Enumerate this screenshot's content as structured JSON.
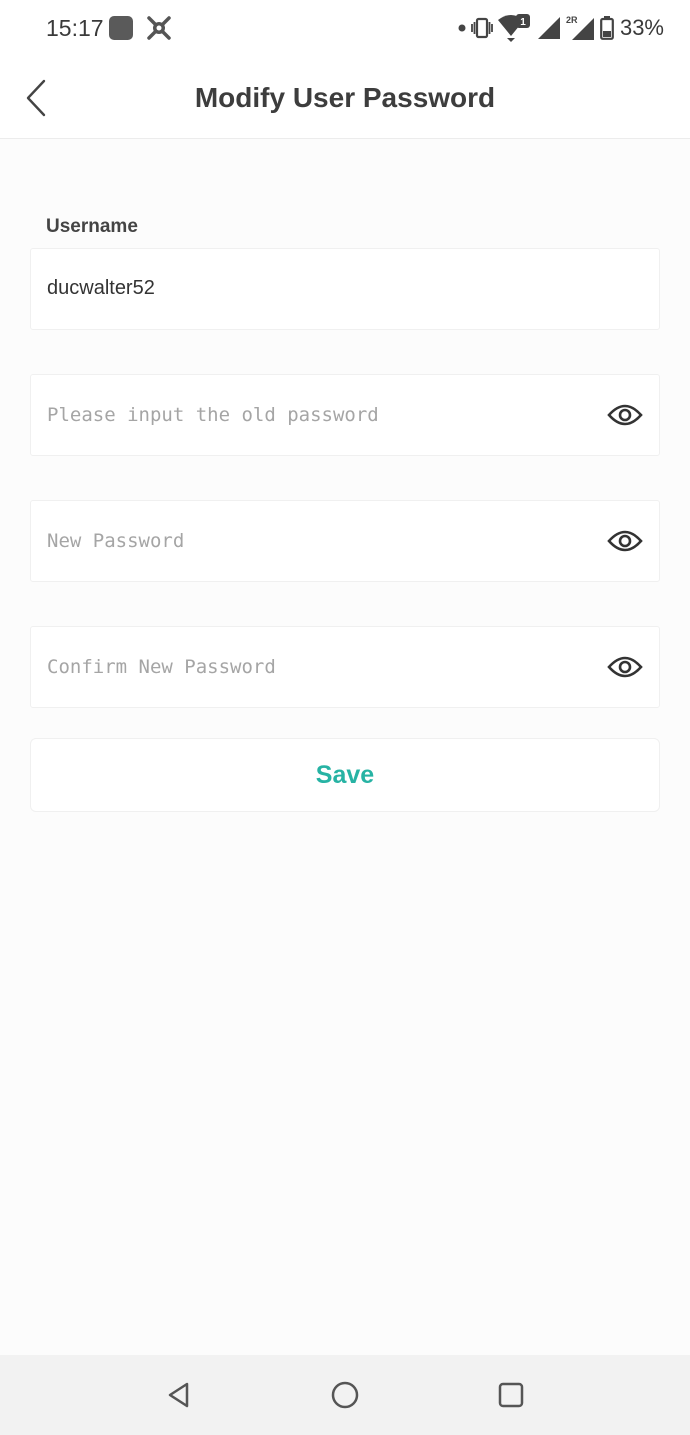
{
  "status_bar": {
    "time": "15:17",
    "battery": "33%",
    "icons": [
      "app-square-icon",
      "bug-icon",
      "dot-icon",
      "vibrate-icon",
      "wifi-icon",
      "signal-icon",
      "signal-2r-icon",
      "battery-icon"
    ],
    "badge_sim1": "1",
    "badge_2r": "2R"
  },
  "header": {
    "back_icon": "chevron-left-icon",
    "title": "Modify User Password"
  },
  "form": {
    "username_label": "Username",
    "username_value": "ducwalter52",
    "old_password_placeholder": "Please input the old password",
    "new_password_placeholder": "New Password",
    "confirm_password_placeholder": "Confirm New Password",
    "toggle_icon": "eye-icon",
    "save_label": "Save"
  },
  "colors": {
    "accent": "#27b3a4",
    "background": "#fcfcfc",
    "card": "#ffffff"
  },
  "nav_bar": {
    "icons": [
      "back-triangle-icon",
      "home-circle-icon",
      "recents-square-icon"
    ]
  }
}
